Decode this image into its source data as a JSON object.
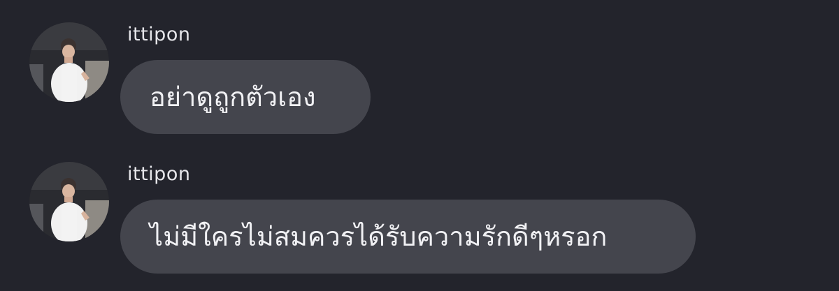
{
  "messages": [
    {
      "username": "ittipon",
      "text": "อย่าดูถูกตัวเอง",
      "avatar_icon": "user-photo-avatar"
    },
    {
      "username": "ittipon",
      "text": "ไม่มีใครไม่สมควรได้รับความรักดีๆหรอก",
      "avatar_icon": "user-photo-avatar"
    }
  ],
  "colors": {
    "background": "#23242c",
    "bubble": "#44454d",
    "text": "#f1f1f4"
  }
}
